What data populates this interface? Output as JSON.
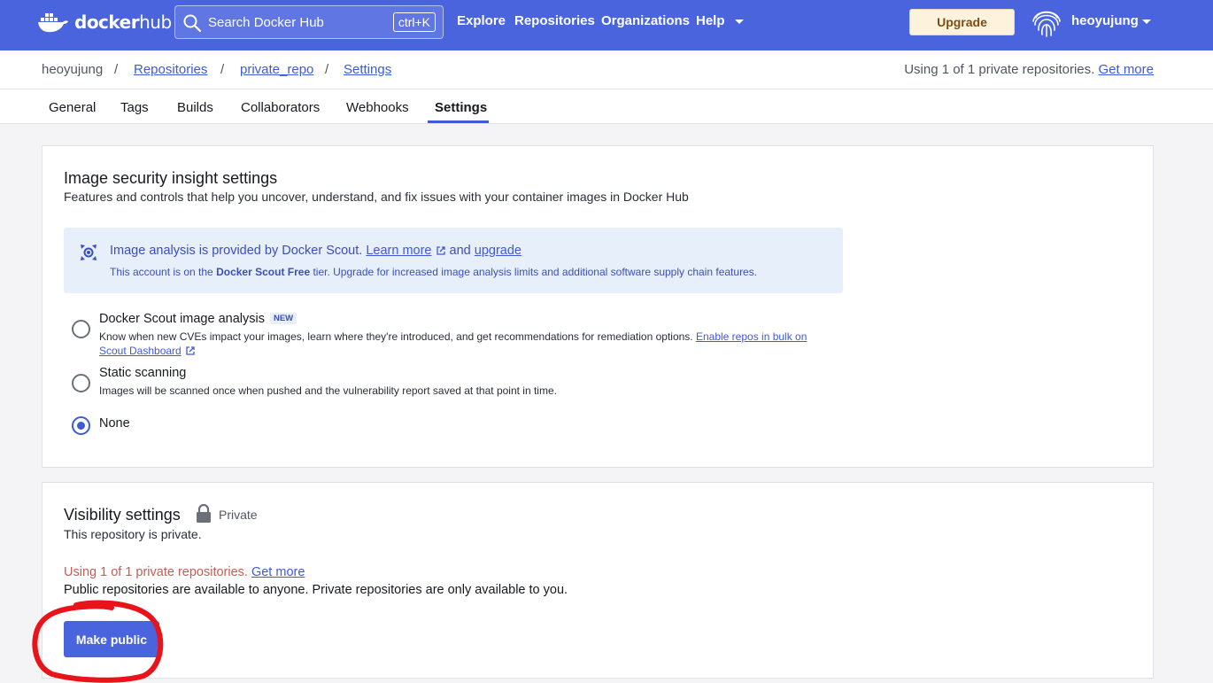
{
  "topnav": {
    "logo_brand": "docker",
    "logo_product": "hub",
    "search_placeholder": "Search Docker Hub",
    "search_shortcut": "ctrl+K",
    "links": [
      "Explore",
      "Repositories",
      "Organizations",
      "Help"
    ],
    "upgrade_label": "Upgrade",
    "username": "heoyujung",
    "colors": {
      "bar": "#4a64de",
      "upgrade_bg": "#fdf2dc"
    }
  },
  "breadcrumb": {
    "owner": "heoyujung",
    "repositories": "Repositories",
    "repo": "private_repo",
    "current": "Settings",
    "separator": "/",
    "quota_text": "Using 1 of 1 private repositories.",
    "quota_link": "Get more"
  },
  "tabs": [
    "General",
    "Tags",
    "Builds",
    "Collaborators",
    "Webhooks",
    "Settings"
  ],
  "active_tab": "Settings",
  "security": {
    "title": "Image security insight settings",
    "subtitle": "Features and controls that help you uncover, understand, and fix issues with your container images in Docker Hub",
    "info": {
      "text": "Image analysis is provided by Docker Scout.",
      "learn_more": "Learn more",
      "and": "and",
      "upgrade": "upgrade",
      "tier_prefix": "This account is on the",
      "tier_name": "Docker Scout Free",
      "tier_suffix": "tier. Upgrade for increased image analysis limits and additional software supply chain features."
    },
    "options": [
      {
        "title": "Docker Scout image analysis",
        "badge": "NEW",
        "desc": "Know when new CVEs impact your images, learn where they're introduced, and get recommendations for remediation options.",
        "link": "Enable repos in bulk on Scout Dashboard",
        "checked": false
      },
      {
        "title": "Static scanning",
        "desc": "Images will be scanned once when pushed and the vulnerability report saved at that point in time.",
        "checked": false
      },
      {
        "title": "None",
        "checked": true
      }
    ]
  },
  "visibility": {
    "title": "Visibility settings",
    "state": "Private",
    "desc": "This repository is private.",
    "warning": "Using 1 of 1 private repositories.",
    "warning_link": "Get more",
    "note": "Public repositories are available to anyone. Private repositories are only available to you.",
    "button": "Make public"
  }
}
